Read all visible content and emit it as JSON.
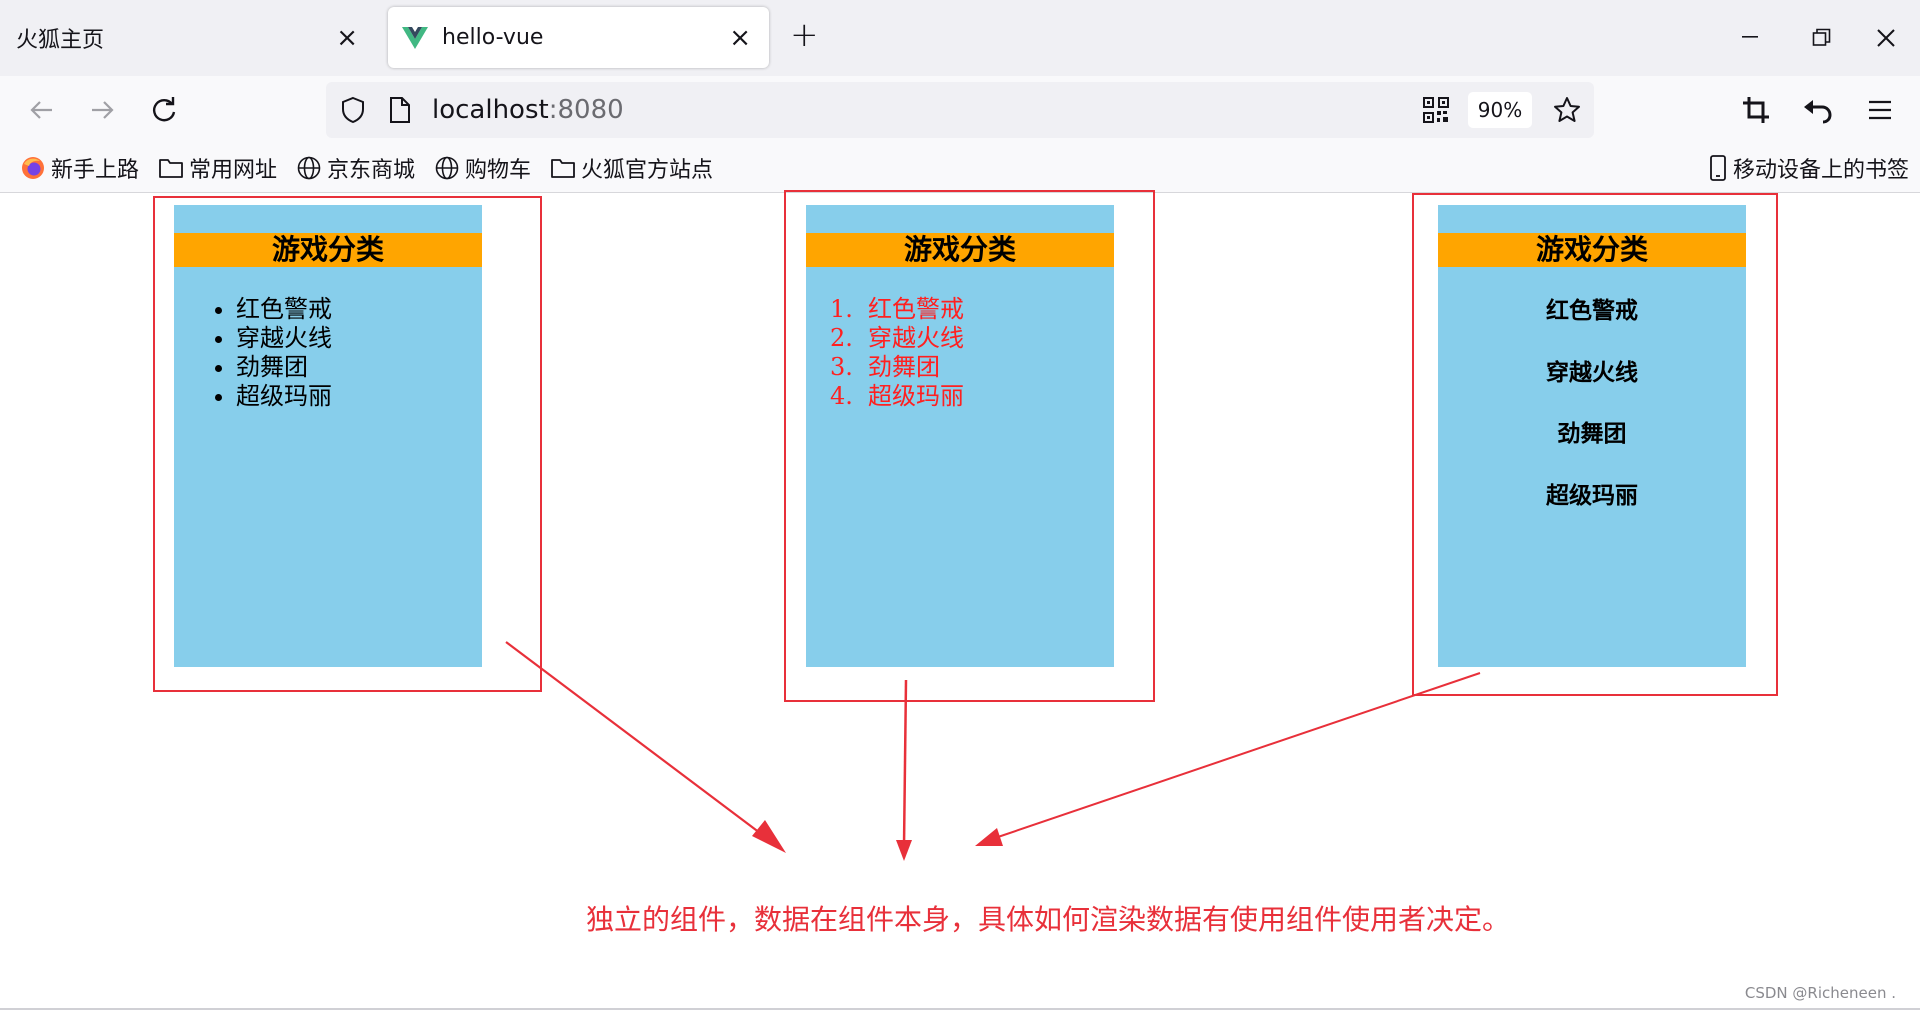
{
  "tabs": [
    {
      "title": "火狐主页",
      "active": false
    },
    {
      "title": "hello-vue",
      "active": true
    }
  ],
  "navbar": {
    "url_host": "localhost",
    "url_port": ":8080",
    "zoom": "90%"
  },
  "bookmarks": [
    {
      "label": "新手上路",
      "icon": "firefox-icon"
    },
    {
      "label": "常用网址",
      "icon": "folder-icon"
    },
    {
      "label": "京东商城",
      "icon": "globe-icon"
    },
    {
      "label": "购物车",
      "icon": "globe-icon"
    },
    {
      "label": "火狐官方站点",
      "icon": "folder-icon"
    },
    {
      "label": "移动设备上的书签",
      "icon": "mobile-icon"
    }
  ],
  "cards": [
    {
      "title": "游戏分类",
      "list_type": "unordered",
      "items": [
        "红色警戒",
        "穿越火线",
        "劲舞团",
        "超级玛丽"
      ]
    },
    {
      "title": "游戏分类",
      "list_type": "ordered",
      "item_color": "#ff2020",
      "numbers": [
        "1.",
        "2.",
        "3.",
        "4."
      ],
      "items": [
        "红色警戒",
        "穿越火线",
        "劲舞团",
        "超级玛丽"
      ]
    },
    {
      "title": "游戏分类",
      "list_type": "headings",
      "items": [
        "红色警戒",
        "穿越火线",
        "劲舞团",
        "超级玛丽"
      ]
    }
  ],
  "colors": {
    "card_bg": "#87ceeb",
    "card_title_bg": "#ffa500",
    "annotation": "#e8303a"
  },
  "annotation": "独立的组件，数据在组件本身，具体如何渲染数据有使用组件使用者决定。",
  "watermark": "CSDN @Richeneen ."
}
